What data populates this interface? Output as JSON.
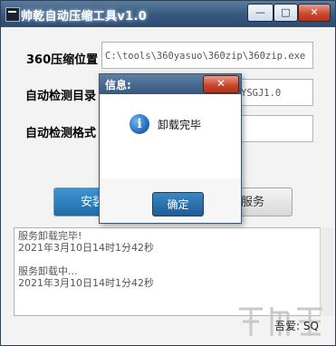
{
  "window": {
    "title": "帅乾自动压缩工具v1.0",
    "min_label": "—",
    "max_label": "□",
    "close_label": "✕"
  },
  "form": {
    "path_label": "360压缩位置",
    "path_value": "C:\\tools\\360yasuo\\360zip\\360zip.exe",
    "dir_label": "自动检测目录",
    "dir_value": "YSGJ1.0",
    "format_label": "自动检测格式",
    "format_value": ""
  },
  "buttons": {
    "install_label": "安装服务",
    "uninstall_label": "卸载服务"
  },
  "log": {
    "lines": [
      "服务卸载完毕!",
      "2021年3月10日14时1分42秒",
      "",
      "服务卸载中...",
      "2021年3月10日14时1分42秒"
    ]
  },
  "footer": {
    "text": "吾爱: SQ"
  },
  "dialog": {
    "title": "信息:",
    "close_label": "✕",
    "icon_glyph": "i",
    "message": "卸载完毕",
    "ok_label": "确定"
  }
}
